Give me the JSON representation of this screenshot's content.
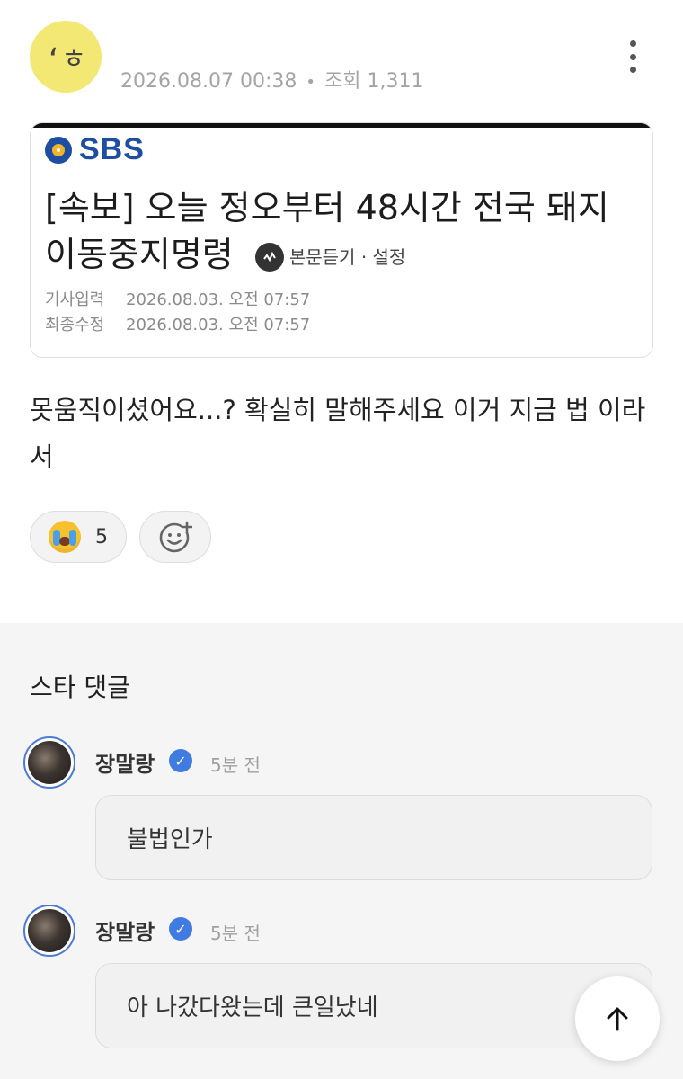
{
  "post": {
    "avatar_glyph": "ʻㅎ",
    "date": "2026.08.07 00:38",
    "separator": "•",
    "views": "조회 1,311",
    "body": "못움직이셨어요...? 확실히 말해주세요 이거 지금 법 이라서"
  },
  "news": {
    "brand": "SBS",
    "headline": "[속보] 오늘 정오부터 48시간 전국 돼지 이동중지명령",
    "listen_label": "본문듣기 · 설정",
    "published_label": "기사입력",
    "published_value": "2026.08.03. 오전 07:57",
    "modified_label": "최종수정",
    "modified_value": "2026.08.03. 오전 07:57"
  },
  "reactions": {
    "emoji_icon": "crying-face-icon",
    "count": "5",
    "add_icon": "add-reaction-icon"
  },
  "star_comments": {
    "title": "스타 댓글",
    "items": [
      {
        "name": "장말랑",
        "time": "5분 전",
        "text": "불법인가"
      },
      {
        "name": "장말랑",
        "time": "5분 전",
        "text": "아 나갔다왔는데 큰일났네"
      }
    ]
  },
  "colors": {
    "avatar_bg": "#f3e873",
    "sbs_blue": "#1e4ea1",
    "verified_blue": "#3f7be0",
    "section_bg": "#f5f5f5"
  }
}
